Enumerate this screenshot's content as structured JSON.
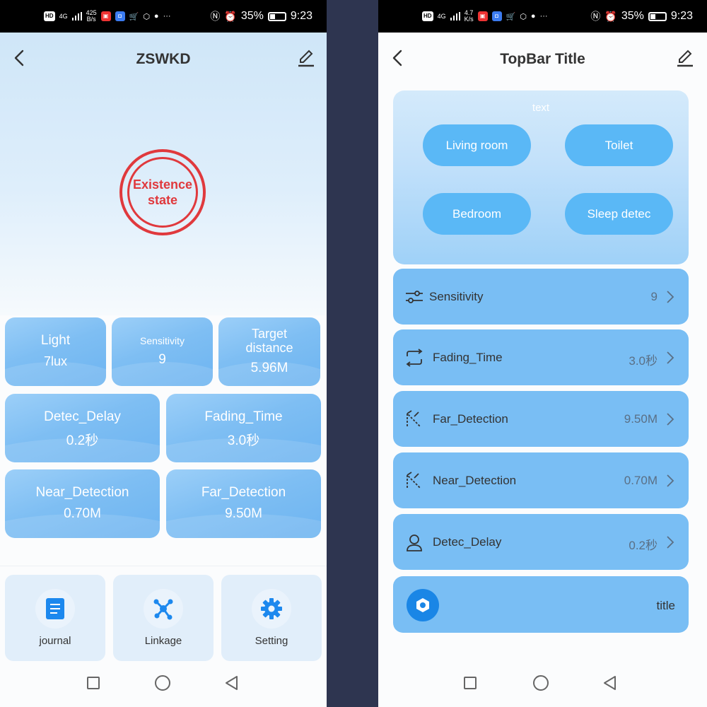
{
  "status_left": {
    "hd": "HD",
    "net": "4G",
    "speed_top": "425",
    "speed_unit": "B/s",
    "battery": "35%",
    "time": "9:23"
  },
  "status_right": {
    "hd": "HD",
    "net": "4G",
    "speed_top": "4.7",
    "speed_unit": "K/s",
    "battery": "35%",
    "time": "9:23"
  },
  "battery_level": 0.35,
  "left": {
    "title": "ZSWKD",
    "existence_line1": "Existence",
    "existence_line2": "state",
    "cards": {
      "light": {
        "label": "Light",
        "value": "7lux"
      },
      "sensitivity": {
        "label": "Sensitivity",
        "value": "9"
      },
      "target": {
        "label1": "Target",
        "label2": "distance",
        "value": "5.96M"
      },
      "detec_delay": {
        "label": "Detec_Delay",
        "value": "0.2秒"
      },
      "fading_time": {
        "label": "Fading_Time",
        "value": "3.0秒"
      },
      "near_detection": {
        "label": "Near_Detection",
        "value": "0.70M"
      },
      "far_detection": {
        "label": "Far_Detection",
        "value": "9.50M"
      }
    },
    "bottom": {
      "journal": "journal",
      "linkage": "Linkage",
      "setting": "Setting"
    }
  },
  "right": {
    "title": "TopBar Title",
    "panel_text": "text",
    "rooms": [
      "Living room",
      "Toilet",
      "Bedroom",
      "Sleep detec"
    ],
    "rows": [
      {
        "label": "Sensitivity",
        "value": "9",
        "icon": "sliders-icon"
      },
      {
        "label": "Fading_Time",
        "value": "3.0秒",
        "icon": "loop-icon"
      },
      {
        "label": "Far_Detection",
        "value": "9.50M",
        "icon": "far-detection-icon"
      },
      {
        "label": "Near_Detection",
        "value": "0.70M",
        "icon": "near-detection-icon"
      },
      {
        "label": "Detec_Delay",
        "value": "0.2秒",
        "icon": "person-icon"
      }
    ],
    "bottom_title": "title"
  },
  "colors": {
    "card_blue": "#79bef4",
    "pill_blue": "#5ab8f6",
    "existence_red": "#e0393d",
    "hex_blue": "#1a86e6"
  }
}
